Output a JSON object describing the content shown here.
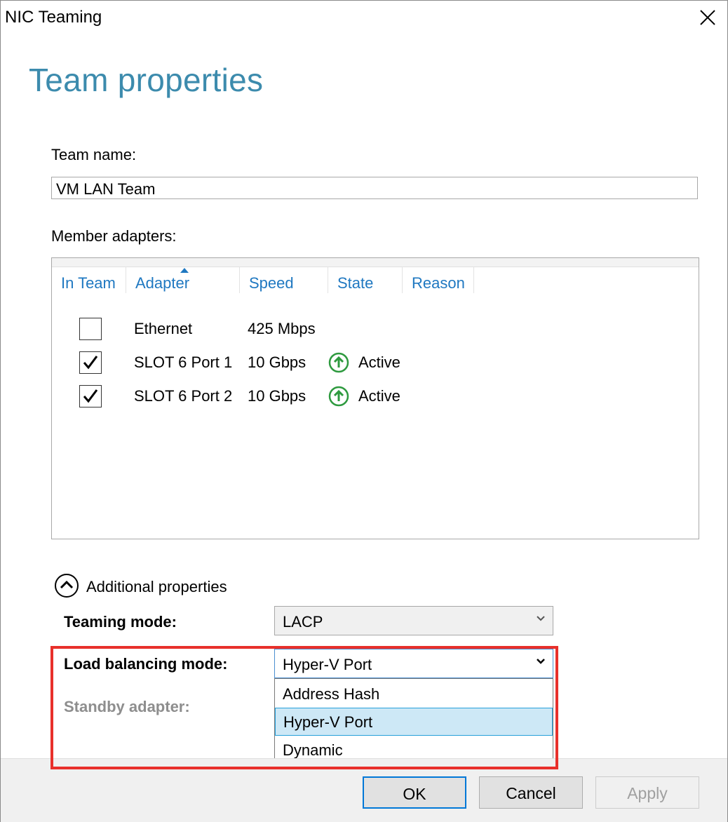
{
  "window": {
    "title": "NIC Teaming"
  },
  "heading": "Team properties",
  "team_name": {
    "label": "Team name:",
    "value": "VM LAN Team"
  },
  "member_adapters": {
    "label": "Member adapters:",
    "columns": [
      "In Team",
      "Adapter",
      "Speed",
      "State",
      "Reason"
    ],
    "sort_column": "Adapter",
    "rows": [
      {
        "in_team": false,
        "adapter": "Ethernet",
        "speed": "425 Mbps",
        "state": "",
        "state_icon": "",
        "reason": ""
      },
      {
        "in_team": true,
        "adapter": "SLOT 6 Port 1",
        "speed": "10 Gbps",
        "state": "Active",
        "state_icon": "up-arrow-circle-icon",
        "reason": ""
      },
      {
        "in_team": true,
        "adapter": "SLOT 6 Port 2",
        "speed": "10 Gbps",
        "state": "Active",
        "state_icon": "up-arrow-circle-icon",
        "reason": ""
      }
    ]
  },
  "additional_properties": {
    "label": "Additional properties",
    "expanded": true,
    "teaming_mode": {
      "label": "Teaming mode:",
      "value": "LACP"
    },
    "load_balancing_mode": {
      "label": "Load balancing mode:",
      "value": "Hyper-V Port",
      "options": [
        "Address Hash",
        "Hyper-V Port",
        "Dynamic"
      ],
      "selected_option": "Hyper-V Port"
    },
    "standby_adapter": {
      "label": "Standby adapter:"
    }
  },
  "buttons": {
    "ok": "OK",
    "cancel": "Cancel",
    "apply": "Apply"
  },
  "colors": {
    "heading": "#3c8bad",
    "column_header": "#1f78c1",
    "state_active": "#2e9a3f",
    "highlight_box": "#e8302b",
    "selected_option_bg": "#cde8f6"
  }
}
